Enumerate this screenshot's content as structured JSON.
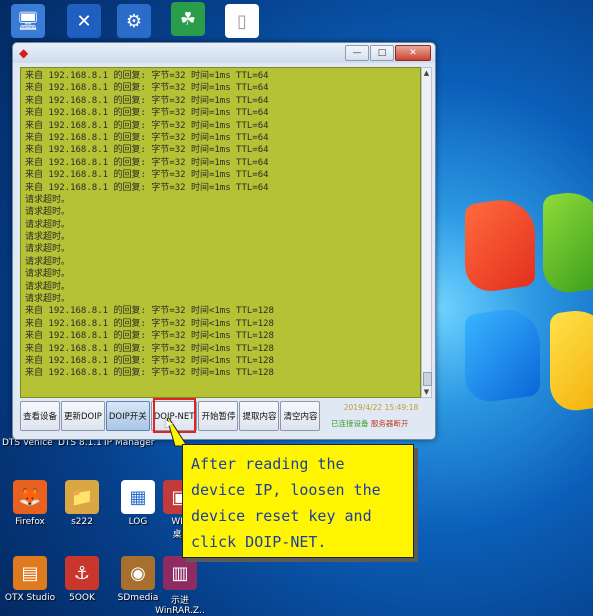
{
  "desktop": {
    "top_icons": [
      {
        "name": "computer-icon",
        "glyph": "🖥"
      },
      {
        "name": "x-app-icon",
        "glyph": "✕"
      },
      {
        "name": "mercedes-app-icon",
        "glyph": "⚙"
      },
      {
        "name": "network-app-icon",
        "glyph": "☘"
      },
      {
        "name": "document-icon",
        "glyph": "▯"
      }
    ],
    "labels_behind_window": [
      "DTS Venice",
      "DTS 8.1.1",
      "IP Manager"
    ],
    "icons": [
      {
        "label": "Firefox",
        "glyph": "🦊"
      },
      {
        "label": "s222",
        "glyph": "📁"
      },
      {
        "label": "LOG",
        "glyph": "▦"
      },
      {
        "label": "WIS\n桌..",
        "glyph": "▣"
      },
      {
        "label": "OTX Studio",
        "glyph": "▤"
      },
      {
        "label": "5OOK",
        "glyph": "⚓"
      },
      {
        "label": "SDmedia",
        "glyph": "◉"
      },
      {
        "label": "示进\nWinRAR.Z..",
        "glyph": "▥"
      }
    ]
  },
  "window": {
    "title_icon": "◆",
    "buttons": {
      "minimize": "—",
      "maximize": "□",
      "close": "✕"
    },
    "console_lines": [
      "来自 192.168.8.1 的回复: 字节=32 时间=1ms TTL=64",
      "来自 192.168.8.1 的回复: 字节=32 时间=1ms TTL=64",
      "来自 192.168.8.1 的回复: 字节=32 时间=1ms TTL=64",
      "来自 192.168.8.1 的回复: 字节=32 时间=1ms TTL=64",
      "来自 192.168.8.1 的回复: 字节=32 时间=1ms TTL=64",
      "来自 192.168.8.1 的回复: 字节=32 时间=1ms TTL=64",
      "来自 192.168.8.1 的回复: 字节=32 时间=1ms TTL=64",
      "来自 192.168.8.1 的回复: 字节=32 时间=1ms TTL=64",
      "来自 192.168.8.1 的回复: 字节=32 时间=1ms TTL=64",
      "来自 192.168.8.1 的回复: 字节=32 时间=1ms TTL=64",
      "请求超时。",
      "请求超时。",
      "请求超时。",
      "请求超时。",
      "请求超时。",
      "请求超时。",
      "请求超时。",
      "请求超时。",
      "请求超时。",
      "来自 192.168.8.1 的回复: 字节=32 时间<1ms TTL=128",
      "来自 192.168.8.1 的回复: 字节=32 时间<1ms TTL=128",
      "来自 192.168.8.1 的回复: 字节=32 时间<1ms TTL=128",
      "来自 192.168.8.1 的回复: 字节=32 时间<1ms TTL=128",
      "来自 192.168.8.1 的回复: 字节=32 时间<1ms TTL=128",
      "来自 192.168.8.1 的回复: 字节=32 时间=1ms TTL=128"
    ],
    "toolbar": [
      {
        "label": "查看设备",
        "name": "view-device-button"
      },
      {
        "label": "更新DOIP",
        "name": "update-doip-button"
      },
      {
        "label": "DOIP开关",
        "name": "doip-switch-button",
        "active": true
      },
      {
        "label": "DOIP-NET",
        "name": "doip-net-button"
      },
      {
        "label": "开始暂停",
        "name": "start-pause-button"
      },
      {
        "label": "提取内容",
        "name": "extract-content-button"
      },
      {
        "label": "清空内容",
        "name": "clear-content-button"
      }
    ],
    "status": {
      "datetime": "2019/4/22 15:49:18",
      "device": "已连接设备",
      "server": "服务器断开"
    }
  },
  "callout": {
    "lines": [
      "After reading the",
      "device IP, loosen the",
      "device reset key and",
      "click DOIP-NET."
    ]
  },
  "colors": {
    "console_bg": "#b5c235",
    "callout_bg": "#fff500",
    "callout_text": "#1d3fa0",
    "highlight": "#e52222"
  }
}
